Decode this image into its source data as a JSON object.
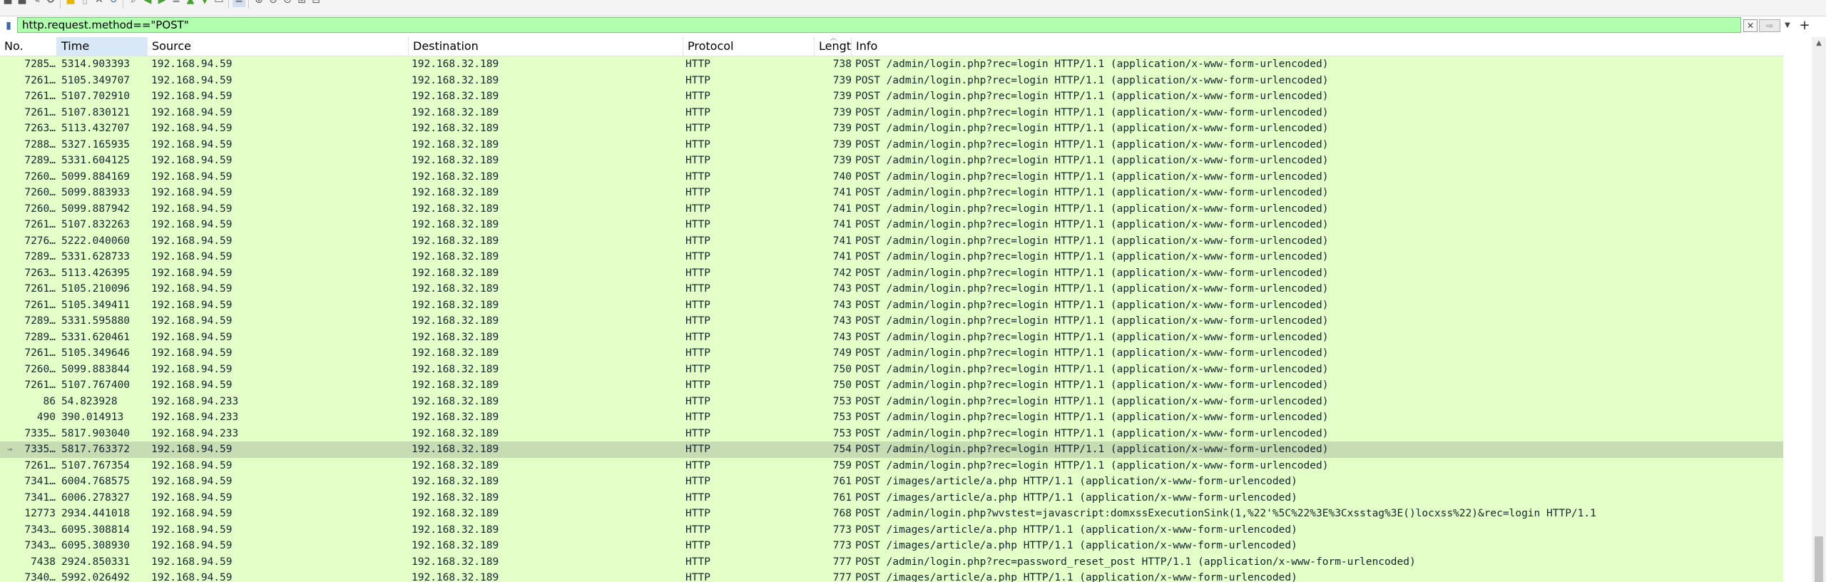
{
  "toolbar": {
    "icons": [
      "stop-icon",
      "restart-icon",
      "options-icon",
      "gear-icon",
      "open-folder-icon",
      "file-icon",
      "close-file-icon",
      "reload-icon",
      "find-icon",
      "back-arrow-icon",
      "forward-arrow-icon",
      "jump-icon",
      "go-first-icon",
      "go-last-icon",
      "autoscroll-icon",
      "colorize-icon",
      "zoom-in-icon",
      "zoom-out-icon",
      "zoom-normal-icon",
      "resize-columns-icon",
      "layout-icon"
    ]
  },
  "filter": {
    "value": "http.request.method==\"POST\""
  },
  "columns": {
    "no": "No.",
    "time": "Time",
    "source": "Source",
    "destination": "Destination",
    "protocol": "Protocol",
    "length": "Lengt",
    "info": "Info"
  },
  "packets": [
    {
      "no": "7285…",
      "time": "5314.903393",
      "src": "192.168.94.59",
      "dst": "192.168.32.189",
      "proto": "HTTP",
      "len": "738",
      "info": "POST /admin/login.php?rec=login HTTP/1.1  (application/x-www-form-urlencoded)"
    },
    {
      "no": "7261…",
      "time": "5105.349707",
      "src": "192.168.94.59",
      "dst": "192.168.32.189",
      "proto": "HTTP",
      "len": "739",
      "info": "POST /admin/login.php?rec=login HTTP/1.1  (application/x-www-form-urlencoded)"
    },
    {
      "no": "7261…",
      "time": "5107.702910",
      "src": "192.168.94.59",
      "dst": "192.168.32.189",
      "proto": "HTTP",
      "len": "739",
      "info": "POST /admin/login.php?rec=login HTTP/1.1  (application/x-www-form-urlencoded)"
    },
    {
      "no": "7261…",
      "time": "5107.830121",
      "src": "192.168.94.59",
      "dst": "192.168.32.189",
      "proto": "HTTP",
      "len": "739",
      "info": "POST /admin/login.php?rec=login HTTP/1.1  (application/x-www-form-urlencoded)"
    },
    {
      "no": "7263…",
      "time": "5113.432707",
      "src": "192.168.94.59",
      "dst": "192.168.32.189",
      "proto": "HTTP",
      "len": "739",
      "info": "POST /admin/login.php?rec=login HTTP/1.1  (application/x-www-form-urlencoded)"
    },
    {
      "no": "7288…",
      "time": "5327.165935",
      "src": "192.168.94.59",
      "dst": "192.168.32.189",
      "proto": "HTTP",
      "len": "739",
      "info": "POST /admin/login.php?rec=login HTTP/1.1  (application/x-www-form-urlencoded)"
    },
    {
      "no": "7289…",
      "time": "5331.604125",
      "src": "192.168.94.59",
      "dst": "192.168.32.189",
      "proto": "HTTP",
      "len": "739",
      "info": "POST /admin/login.php?rec=login HTTP/1.1  (application/x-www-form-urlencoded)"
    },
    {
      "no": "7260…",
      "time": "5099.884169",
      "src": "192.168.94.59",
      "dst": "192.168.32.189",
      "proto": "HTTP",
      "len": "740",
      "info": "POST /admin/login.php?rec=login HTTP/1.1  (application/x-www-form-urlencoded)"
    },
    {
      "no": "7260…",
      "time": "5099.883933",
      "src": "192.168.94.59",
      "dst": "192.168.32.189",
      "proto": "HTTP",
      "len": "741",
      "info": "POST /admin/login.php?rec=login HTTP/1.1  (application/x-www-form-urlencoded)"
    },
    {
      "no": "7260…",
      "time": "5099.887942",
      "src": "192.168.94.59",
      "dst": "192.168.32.189",
      "proto": "HTTP",
      "len": "741",
      "info": "POST /admin/login.php?rec=login HTTP/1.1  (application/x-www-form-urlencoded)"
    },
    {
      "no": "7261…",
      "time": "5107.832263",
      "src": "192.168.94.59",
      "dst": "192.168.32.189",
      "proto": "HTTP",
      "len": "741",
      "info": "POST /admin/login.php?rec=login HTTP/1.1  (application/x-www-form-urlencoded)"
    },
    {
      "no": "7276…",
      "time": "5222.040060",
      "src": "192.168.94.59",
      "dst": "192.168.32.189",
      "proto": "HTTP",
      "len": "741",
      "info": "POST /admin/login.php?rec=login HTTP/1.1  (application/x-www-form-urlencoded)"
    },
    {
      "no": "7289…",
      "time": "5331.628733",
      "src": "192.168.94.59",
      "dst": "192.168.32.189",
      "proto": "HTTP",
      "len": "741",
      "info": "POST /admin/login.php?rec=login HTTP/1.1  (application/x-www-form-urlencoded)"
    },
    {
      "no": "7263…",
      "time": "5113.426395",
      "src": "192.168.94.59",
      "dst": "192.168.32.189",
      "proto": "HTTP",
      "len": "742",
      "info": "POST /admin/login.php?rec=login HTTP/1.1  (application/x-www-form-urlencoded)"
    },
    {
      "no": "7261…",
      "time": "5105.210096",
      "src": "192.168.94.59",
      "dst": "192.168.32.189",
      "proto": "HTTP",
      "len": "743",
      "info": "POST /admin/login.php?rec=login HTTP/1.1  (application/x-www-form-urlencoded)"
    },
    {
      "no": "7261…",
      "time": "5105.349411",
      "src": "192.168.94.59",
      "dst": "192.168.32.189",
      "proto": "HTTP",
      "len": "743",
      "info": "POST /admin/login.php?rec=login HTTP/1.1  (application/x-www-form-urlencoded)"
    },
    {
      "no": "7289…",
      "time": "5331.595880",
      "src": "192.168.94.59",
      "dst": "192.168.32.189",
      "proto": "HTTP",
      "len": "743",
      "info": "POST /admin/login.php?rec=login HTTP/1.1  (application/x-www-form-urlencoded)"
    },
    {
      "no": "7289…",
      "time": "5331.620461",
      "src": "192.168.94.59",
      "dst": "192.168.32.189",
      "proto": "HTTP",
      "len": "743",
      "info": "POST /admin/login.php?rec=login HTTP/1.1  (application/x-www-form-urlencoded)"
    },
    {
      "no": "7261…",
      "time": "5105.349646",
      "src": "192.168.94.59",
      "dst": "192.168.32.189",
      "proto": "HTTP",
      "len": "749",
      "info": "POST /admin/login.php?rec=login HTTP/1.1  (application/x-www-form-urlencoded)"
    },
    {
      "no": "7260…",
      "time": "5099.883844",
      "src": "192.168.94.59",
      "dst": "192.168.32.189",
      "proto": "HTTP",
      "len": "750",
      "info": "POST /admin/login.php?rec=login HTTP/1.1  (application/x-www-form-urlencoded)"
    },
    {
      "no": "7261…",
      "time": "5107.767400",
      "src": "192.168.94.59",
      "dst": "192.168.32.189",
      "proto": "HTTP",
      "len": "750",
      "info": "POST /admin/login.php?rec=login HTTP/1.1  (application/x-www-form-urlencoded)"
    },
    {
      "no": "86",
      "time": "54.823928",
      "src": "192.168.94.233",
      "dst": "192.168.32.189",
      "proto": "HTTP",
      "len": "753",
      "info": "POST /admin/login.php?rec=login HTTP/1.1  (application/x-www-form-urlencoded)"
    },
    {
      "no": "490",
      "time": "390.014913",
      "src": "192.168.94.233",
      "dst": "192.168.32.189",
      "proto": "HTTP",
      "len": "753",
      "info": "POST /admin/login.php?rec=login HTTP/1.1  (application/x-www-form-urlencoded)"
    },
    {
      "no": "7335…",
      "time": "5817.903040",
      "src": "192.168.94.233",
      "dst": "192.168.32.189",
      "proto": "HTTP",
      "len": "753",
      "info": "POST /admin/login.php?rec=login HTTP/1.1  (application/x-www-form-urlencoded)"
    },
    {
      "no": "7335…",
      "time": "5817.763372",
      "src": "192.168.94.59",
      "dst": "192.168.32.189",
      "proto": "HTTP",
      "len": "754",
      "info": "POST /admin/login.php?rec=login HTTP/1.1  (application/x-www-form-urlencoded)",
      "selected": true
    },
    {
      "no": "7261…",
      "time": "5107.767354",
      "src": "192.168.94.59",
      "dst": "192.168.32.189",
      "proto": "HTTP",
      "len": "759",
      "info": "POST /admin/login.php?rec=login HTTP/1.1  (application/x-www-form-urlencoded)"
    },
    {
      "no": "7341…",
      "time": "6004.768575",
      "src": "192.168.94.59",
      "dst": "192.168.32.189",
      "proto": "HTTP",
      "len": "761",
      "info": "POST /images/article/a.php HTTP/1.1  (application/x-www-form-urlencoded)"
    },
    {
      "no": "7341…",
      "time": "6006.278327",
      "src": "192.168.94.59",
      "dst": "192.168.32.189",
      "proto": "HTTP",
      "len": "761",
      "info": "POST /images/article/a.php HTTP/1.1  (application/x-www-form-urlencoded)"
    },
    {
      "no": "12773",
      "time": "2934.441018",
      "src": "192.168.94.59",
      "dst": "192.168.32.189",
      "proto": "HTTP",
      "len": "768",
      "info": "POST /admin/login.php?wvstest=javascript:domxssExecutionSink(1,%22'%5C%22%3E%3Cxsstag%3E()locxss%22)&rec=login HTTP/1.1"
    },
    {
      "no": "7343…",
      "time": "6095.308814",
      "src": "192.168.94.59",
      "dst": "192.168.32.189",
      "proto": "HTTP",
      "len": "773",
      "info": "POST /images/article/a.php HTTP/1.1  (application/x-www-form-urlencoded)"
    },
    {
      "no": "7343…",
      "time": "6095.308930",
      "src": "192.168.94.59",
      "dst": "192.168.32.189",
      "proto": "HTTP",
      "len": "773",
      "info": "POST /images/article/a.php HTTP/1.1  (application/x-www-form-urlencoded)"
    },
    {
      "no": "7438",
      "time": "2924.850331",
      "src": "192.168.94.59",
      "dst": "192.168.32.189",
      "proto": "HTTP",
      "len": "777",
      "info": "POST /admin/login.php?rec=password_reset_post HTTP/1.1  (application/x-www-form-urlencoded)"
    },
    {
      "no": "7340…",
      "time": "5992.026492",
      "src": "192.168.94.59",
      "dst": "192.168.32.189",
      "proto": "HTTP",
      "len": "777",
      "info": "POST /images/article/a.php HTTP/1.1  (application/x-www-form-urlencoded)"
    }
  ],
  "colors": {
    "row_bg": "#e4ffc7",
    "row_selected_bg": "#c8dcb3",
    "row_text": "#12272e",
    "filter_valid_bg": "#afffaf"
  }
}
